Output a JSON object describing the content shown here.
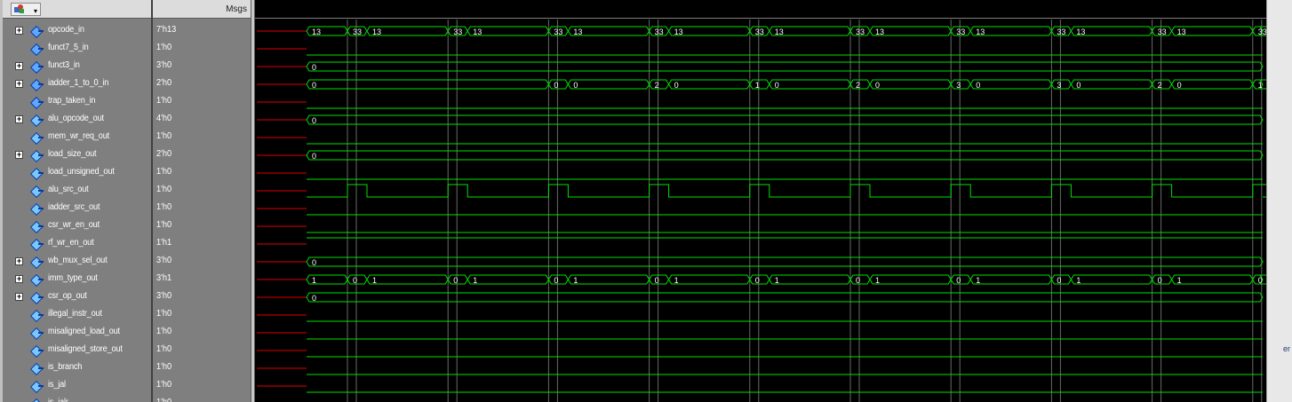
{
  "header": {
    "msgs_label": "Msgs"
  },
  "rows": [
    {
      "name": "opcode_in",
      "value": "7'h13",
      "bus": true,
      "dir": "in"
    },
    {
      "name": "funct7_5_in",
      "value": "1'h0",
      "bus": false,
      "dir": "in"
    },
    {
      "name": "funct3_in",
      "value": "3'h0",
      "bus": true,
      "dir": "in"
    },
    {
      "name": "iadder_1_to_0_in",
      "value": "2'h0",
      "bus": true,
      "dir": "in"
    },
    {
      "name": "trap_taken_in",
      "value": "1'h0",
      "bus": false,
      "dir": "in"
    },
    {
      "name": "alu_opcode_out",
      "value": "4'h0",
      "bus": true,
      "dir": "out"
    },
    {
      "name": "mem_wr_req_out",
      "value": "1'h0",
      "bus": false,
      "dir": "out"
    },
    {
      "name": "load_size_out",
      "value": "2'h0",
      "bus": true,
      "dir": "out"
    },
    {
      "name": "load_unsigned_out",
      "value": "1'h0",
      "bus": false,
      "dir": "out"
    },
    {
      "name": "alu_src_out",
      "value": "1'h0",
      "bus": false,
      "dir": "out"
    },
    {
      "name": "iadder_src_out",
      "value": "1'h0",
      "bus": false,
      "dir": "out"
    },
    {
      "name": "csr_wr_en_out",
      "value": "1'h0",
      "bus": false,
      "dir": "out"
    },
    {
      "name": "rf_wr_en_out",
      "value": "1'h1",
      "bus": false,
      "dir": "out"
    },
    {
      "name": "wb_mux_sel_out",
      "value": "3'h0",
      "bus": true,
      "dir": "out"
    },
    {
      "name": "imm_type_out",
      "value": "3'h1",
      "bus": true,
      "dir": "out"
    },
    {
      "name": "csr_op_out",
      "value": "3'h0",
      "bus": true,
      "dir": "out"
    },
    {
      "name": "illegal_instr_out",
      "value": "1'h0",
      "bus": false,
      "dir": "out"
    },
    {
      "name": "misaligned_load_out",
      "value": "1'h0",
      "bus": false,
      "dir": "out"
    },
    {
      "name": "misaligned_store_out",
      "value": "1'h0",
      "bus": false,
      "dir": "out"
    },
    {
      "name": "is_branch",
      "value": "1'h0",
      "bus": false,
      "dir": "out"
    },
    {
      "name": "is_jal",
      "value": "1'h0",
      "bus": false,
      "dir": "out"
    },
    {
      "name": "is_jalr",
      "value": "1'h0",
      "bus": false,
      "dir": "out"
    }
  ],
  "waves": {
    "periods": 10,
    "opcode_in": {
      "base": "13",
      "pulse": "33"
    },
    "iadder_1_to_0_in": {
      "base": "0",
      "pulse_values": [
        "0",
        "2",
        "1",
        "2",
        "3",
        "3",
        "2",
        "1"
      ]
    },
    "imm_type_out": {
      "base": "1",
      "pulse": "0"
    },
    "const_labels": {
      "funct3_in": "0",
      "alu_opcode_out": "0",
      "load_size_out": "0",
      "wb_mux_sel_out": "0",
      "csr_op_out": "0"
    }
  },
  "colors": {
    "wave": "#00e000",
    "bg": "#000000",
    "grid": "#6a6a6a",
    "undriven": "#e00000",
    "text": "#ffffff"
  },
  "right_strip_text": "er"
}
